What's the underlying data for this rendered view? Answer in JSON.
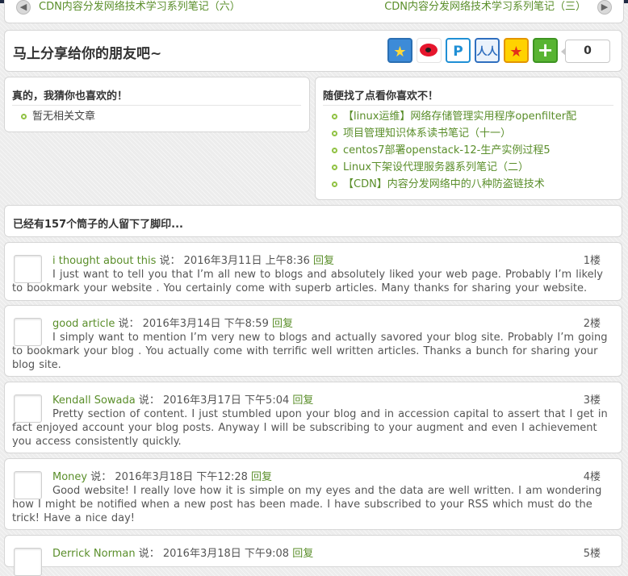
{
  "nav": {
    "prev_title": "CDN内容分发网络技术学习系列笔记（六）",
    "next_title": "CDN内容分发网络技术学习系列笔记（三）",
    "prev_icon": "chevron-left-icon",
    "next_icon": "chevron-right-icon"
  },
  "share": {
    "title": "马上分享给你的朋友吧~",
    "count": "0",
    "icons": [
      "qzone-icon",
      "weibo-icon",
      "pinterest-icon",
      "renren-icon",
      "kaixin-icon",
      "more-share-icon"
    ],
    "icon_glyphs": {
      "qzone": "★",
      "pinterest": "P",
      "renren": "人人",
      "kaixin": "★",
      "more": "+"
    }
  },
  "related": {
    "title": "真的，我猜你也喜欢的！",
    "items": [
      "暂无相关文章"
    ]
  },
  "random": {
    "title": "随便找了点看你喜欢不！",
    "items": [
      "【linux运维】网络存储管理实用程序openfilter配",
      "项目管理知识体系读书笔记（十一）",
      "centos7部署openstack-12-生产实例过程5",
      "Linux下架设代理服务器系列笔记（二）",
      "【CDN】内容分发网络中的八种防盗链技术"
    ]
  },
  "comments_count_text": "已经有157个筒子的人留下了脚印...",
  "comments": [
    {
      "author": "i thought about this",
      "say": "说：",
      "time": "2016年3月11日 上午8:36",
      "reply": "回复",
      "floor": "1楼",
      "text": "I just want to tell you that I’m all new to blogs and absolutely liked your web page. Probably I’m likely to bookmark your website . You certainly come with superb articles. Many thanks for sharing your website."
    },
    {
      "author": "good article",
      "say": "说：",
      "time": "2016年3月14日 下午8:59",
      "reply": "回复",
      "floor": "2楼",
      "text": "I simply want to mention I’m very new to blogs and actually savored your blog site. Probably I’m going to bookmark your blog . You actually come with terrific well written articles. Thanks a bunch for sharing your blog site."
    },
    {
      "author": "Kendall Sowada",
      "say": "说：",
      "time": "2016年3月17日 下午5:04",
      "reply": "回复",
      "floor": "3楼",
      "text": "Pretty section of content. I just stumbled upon your blog and in accession capital to assert that I get in fact enjoyed account your blog posts. Anyway I will be subscribing to your augment and even I achievement you access consistently quickly."
    },
    {
      "author": "Money",
      "say": "说：",
      "time": "2016年3月18日 下午12:28",
      "reply": "回复",
      "floor": "4楼",
      "text": "Good website! I really love how it is simple on my eyes and the data are well written. I am wondering how I might be notified when a new post has been made. I have subscribed to your RSS which must do the trick! Have a nice day!"
    },
    {
      "author": "Derrick Norman",
      "say": "说：",
      "time": "2016年3月18日 下午9:08",
      "reply": "回复",
      "floor": "5楼",
      "text": ""
    }
  ]
}
